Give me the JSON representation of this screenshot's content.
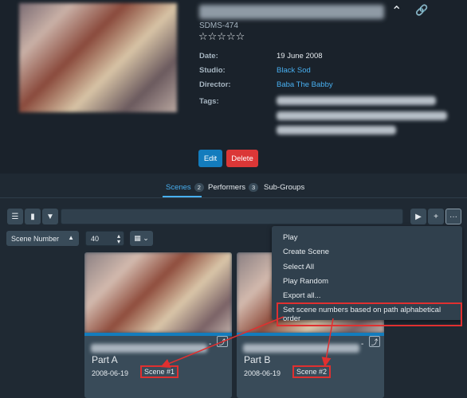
{
  "group": {
    "code": "SDMS-474",
    "rating_stars": "☆☆☆☆☆",
    "fields": {
      "date_label": "Date:",
      "date": "19 June 2008",
      "studio_label": "Studio:",
      "studio": "Black Sod",
      "director_label": "Director:",
      "director": "Baba The Babby",
      "tags_label": "Tags:"
    },
    "edit_label": "Edit",
    "delete_label": "Delete"
  },
  "tabs": [
    {
      "label": "Scenes",
      "count": "2"
    },
    {
      "label": "Performers",
      "count": "3"
    },
    {
      "label": "Sub-Groups",
      "count": ""
    }
  ],
  "toolbar": {
    "sort_value": "Scene Number",
    "per_page": "40"
  },
  "menu": {
    "items": [
      "Play",
      "Create Scene",
      "Select All",
      "Play Random",
      "Export all...",
      "Set scene numbers based on path alphabetical order"
    ]
  },
  "cards": [
    {
      "title": "Part A",
      "date": "2008-06-19",
      "scene": "Scene #1"
    },
    {
      "title": "Part B",
      "date": "2008-06-19",
      "scene": "Scene #2"
    }
  ],
  "colors": {
    "accent": "#48aff0",
    "edit": "#137cbd",
    "delete": "#db3737",
    "annotation": "#e03030"
  }
}
